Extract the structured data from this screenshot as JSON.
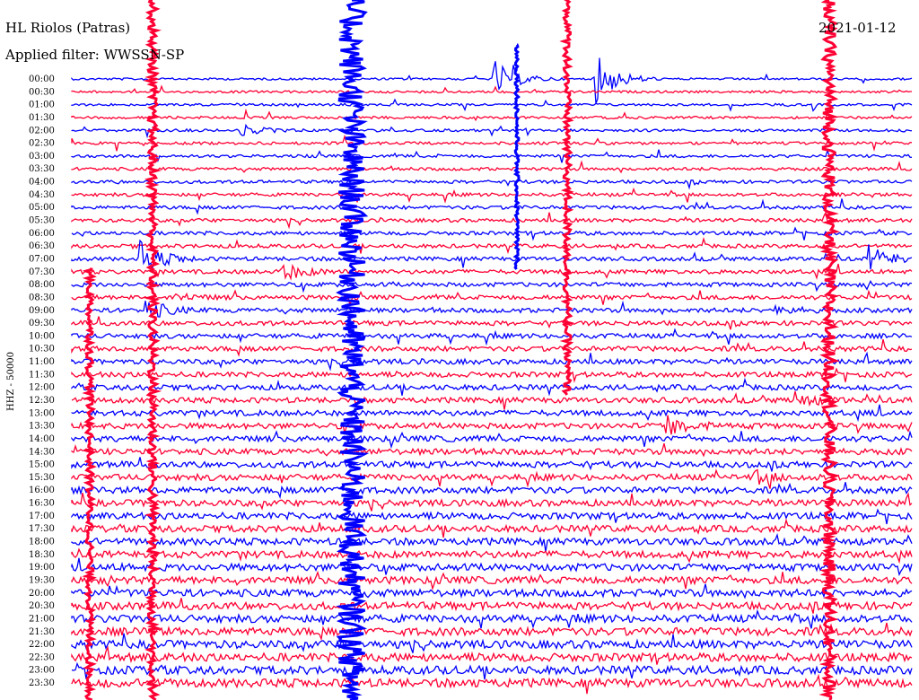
{
  "header": {
    "station": "HL Riolos (Patras)",
    "date": "2021-01-12",
    "filter": "Applied filter: WWSSN-SP"
  },
  "chart_data": {
    "type": "line",
    "title": "HL Riolos (Patras)",
    "subtitle": "Applied filter: WWSSN-SP",
    "date": "2021-01-12",
    "ylabel": "HHZ - 50000",
    "colors": [
      "#0000ff",
      "#ff0033"
    ],
    "trace_minutes": 15,
    "row_labels": [
      "00:00",
      "00:30",
      "01:00",
      "01:30",
      "02:00",
      "02:30",
      "03:00",
      "03:30",
      "04:00",
      "04:30",
      "05:00",
      "05:30",
      "06:00",
      "06:30",
      "07:00",
      "07:30",
      "08:00",
      "08:30",
      "09:00",
      "09:30",
      "10:00",
      "10:30",
      "11:00",
      "11:30",
      "12:00",
      "12:30",
      "13:00",
      "13:30",
      "14:00",
      "14:30",
      "15:00",
      "15:30",
      "16:00",
      "16:30",
      "17:00",
      "17:30",
      "18:00",
      "18:30",
      "19:00",
      "19:30",
      "20:00",
      "20:30",
      "21:00",
      "21:30",
      "22:00",
      "22:30",
      "23:00",
      "23:30"
    ],
    "events": [
      {
        "row_time": "07:00",
        "minute": 1.2,
        "amplitude": 5
      },
      {
        "row_time": "09:00",
        "minute": 1.3,
        "amplitude": 3
      },
      {
        "row_time": "02:00",
        "minute": 3.0,
        "amplitude": 1.5
      },
      {
        "row_time": "07:30",
        "minute": 3.7,
        "amplitude": 3
      },
      {
        "row_time": "08:30",
        "minute": 1.8,
        "amplitude": 1.2
      },
      {
        "row_time": "00:00",
        "minute": 9.3,
        "amplitude": 8
      },
      {
        "row_time": "00:00",
        "minute": 7.5,
        "amplitude": 6
      },
      {
        "row_time": "13:30",
        "minute": 10.6,
        "amplitude": 3
      },
      {
        "row_time": "09:00",
        "minute": 12.5,
        "amplitude": 1.5
      },
      {
        "row_time": "07:00",
        "minute": 14.2,
        "amplitude": 4
      },
      {
        "row_time": "12:30",
        "minute": 12.9,
        "amplitude": 2
      },
      {
        "row_time": "15:30",
        "minute": 12.2,
        "amplitude": 1.5
      }
    ]
  }
}
